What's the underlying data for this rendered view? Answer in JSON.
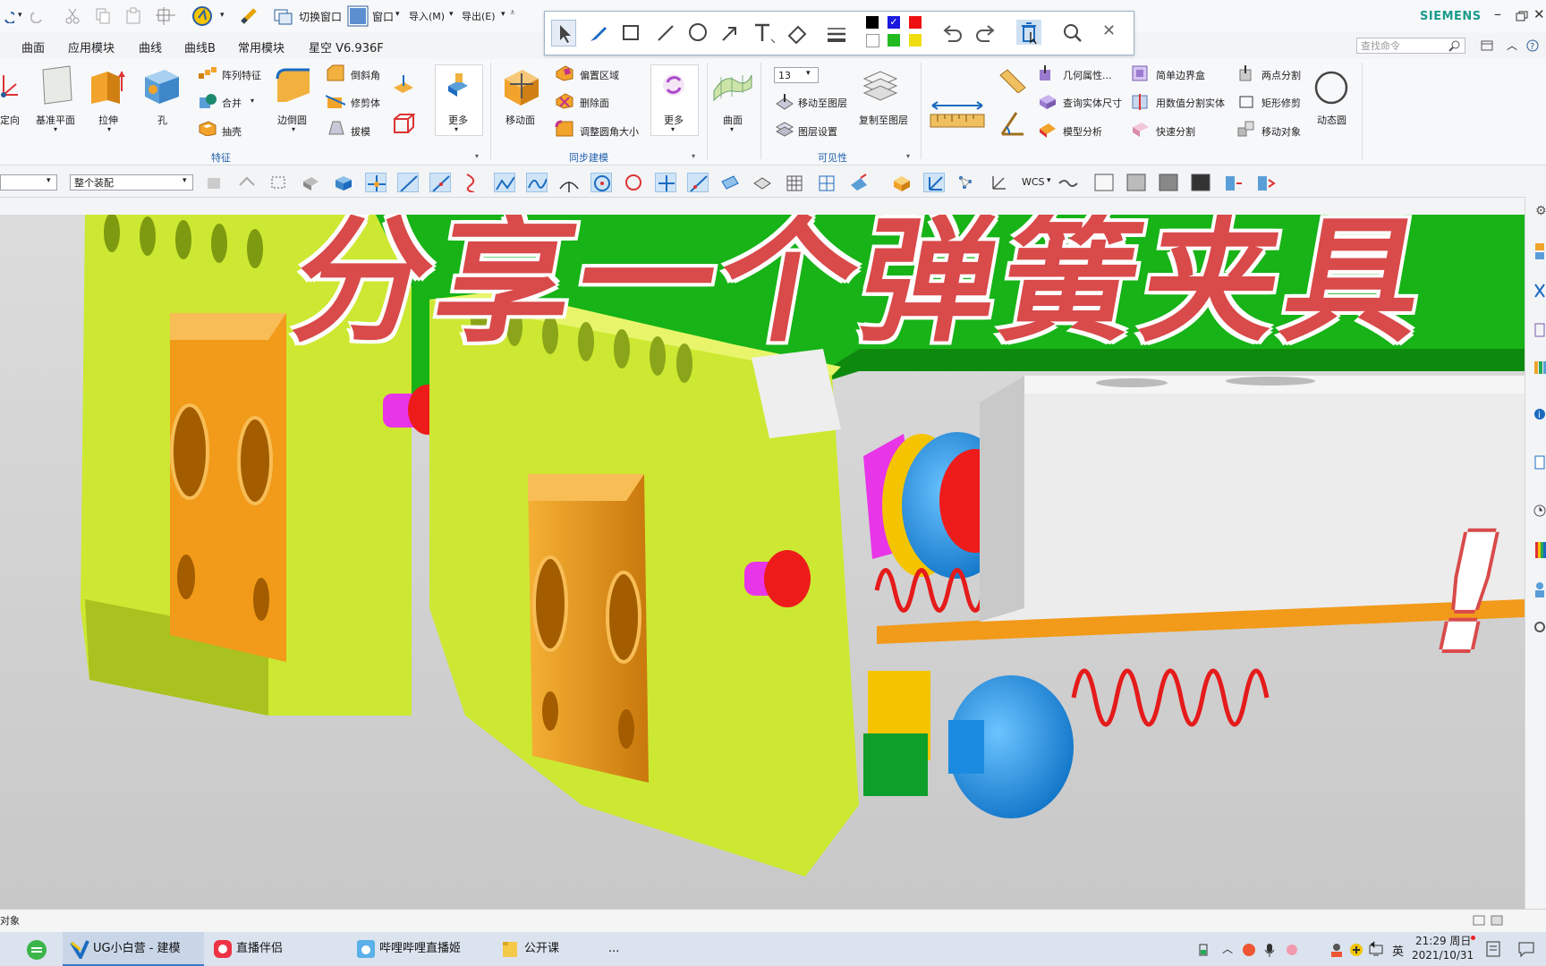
{
  "titlebar": {
    "brand": "SIEMENS"
  },
  "menu": {
    "items": [
      "曲面",
      "应用模块",
      "曲线",
      "曲线B",
      "常用模块",
      "星空 V6.936F"
    ]
  },
  "quick_access": {
    "switch_window": "切换窗口",
    "window": "窗口",
    "import": "导入(M)",
    "export": "导出(E)"
  },
  "search": {
    "placeholder": "查找命令"
  },
  "ribbon": {
    "feature_group": {
      "label": "特征",
      "orient": "定向",
      "datum_plane": "基准平面",
      "extrude": "拉伸",
      "hole": "孔",
      "pattern": "阵列特征",
      "unite": "合并",
      "shell": "抽壳",
      "edge_blend": "边倒圆",
      "chamfer": "倒斜角",
      "trim_body": "修剪体",
      "draft": "拔模",
      "more": "更多"
    },
    "sync_group": {
      "label": "同步建模",
      "move_face": "移动面",
      "offset_region": "偏置区域",
      "delete_face": "删除面",
      "resize_blend": "调整圆角大小",
      "more": "更多"
    },
    "surface": {
      "label": "曲面"
    },
    "visibility_group": {
      "label": "可见性",
      "layer_value": "13",
      "move_to_layer": "移动至图层",
      "layer_settings": "图层设置",
      "copy_to_layer": "复制至图层"
    },
    "analysis": {
      "geom_props": "几何属性...",
      "measure_solid": "查询实体尺寸",
      "model_analysis": "模型分析",
      "bounding_box": "简单边界盒",
      "split_by_value": "用数值分割实体",
      "quick_split": "快速分割",
      "two_point_split": "两点分割",
      "rect_trim": "矩形修剪",
      "move_object": "移动对象",
      "dynamic_circle": "动态圆"
    }
  },
  "selection_bar": {
    "filter": "",
    "scope": "整个装配",
    "wcs": "WCS"
  },
  "overlay": {
    "title": "分享一个弹簧夹具",
    "exclaim": "!"
  },
  "status": {
    "text": "对象"
  },
  "taskbar": {
    "apps": [
      "UG小白营 - 建模",
      "直播伴侣",
      "哔哩哔哩直播姬",
      "公开课"
    ],
    "more": "...",
    "ime": "英",
    "time": "21:29 周日",
    "date": "2021/10/31"
  },
  "colors": {
    "title_red": "#d94a4a",
    "model_yellow_green": "#cde832",
    "model_orange": "#f29a1a",
    "model_green": "#19b419",
    "spring_red": "#e52020",
    "blue": "#1a8be0"
  }
}
